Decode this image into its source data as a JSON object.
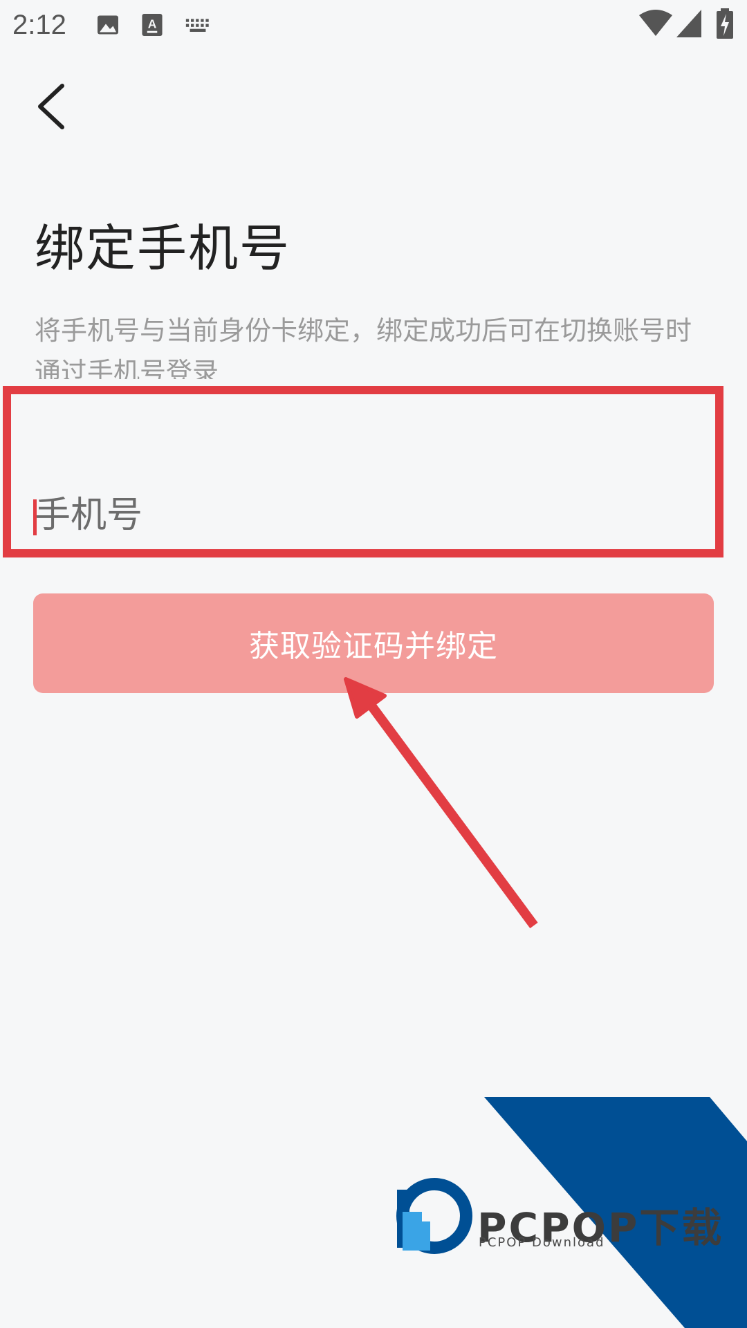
{
  "status_bar": {
    "time": "2:12",
    "icons": [
      "image-icon",
      "keyboard-a-icon",
      "keyboard-icon",
      "wifi-icon",
      "signal-icon",
      "battery-charging-icon"
    ]
  },
  "header": {
    "back_icon": "chevron-left-icon"
  },
  "main": {
    "title": "绑定手机号",
    "description": "将手机号与当前身份卡绑定，绑定成功后可在切换账号时通过手机号登录",
    "phone_input": {
      "value": "",
      "placeholder": "手机号"
    },
    "submit_label": "获取验证码并绑定"
  },
  "watermark": {
    "brand": "PCPOP下载",
    "subtitle": "PCPOP Download"
  },
  "colors": {
    "background": "#f6f7f8",
    "accent_red": "#e23d43",
    "button_fill": "#f39c9a",
    "watermark_blue": "#004f94",
    "logo_light_blue": "#3aa4e6"
  }
}
